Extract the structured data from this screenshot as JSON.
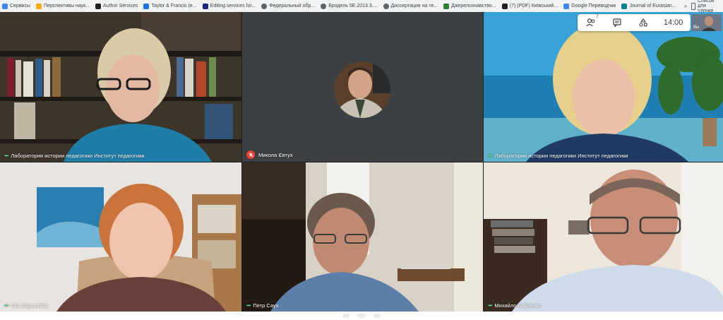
{
  "bookmarks": {
    "items": [
      {
        "label": "Сервисы",
        "icon": "apps-grid-icon",
        "color": "#4285f4"
      },
      {
        "label": "Перспективы наук...",
        "icon": "folder-icon",
        "color": "#f9ab00"
      },
      {
        "label": "Author Services",
        "icon": "page-icon",
        "color": "#202124"
      },
      {
        "label": "Taylor & Francis (e...",
        "icon": "page-icon",
        "color": "#1a73e8"
      },
      {
        "label": "Editing services for...",
        "icon": "page-icon",
        "color": "#1a237e"
      },
      {
        "label": "Федеральный обр...",
        "icon": "globe-icon",
        "color": "#5f6368"
      },
      {
        "label": "Бродель 5Е.2013.3....",
        "icon": "globe-icon",
        "color": "#5f6368"
      },
      {
        "label": "Диссертация на те...",
        "icon": "globe-icon",
        "color": "#5f6368"
      },
      {
        "label": "Джерелознавство...",
        "icon": "page-icon",
        "color": "#2e7d32"
      },
      {
        "label": "(7) (PDF) Київський...",
        "icon": "page-icon",
        "color": "#202124"
      },
      {
        "label": "Google Переводчик",
        "icon": "translate-icon",
        "color": "#4285f4"
      },
      {
        "label": "Journal of Eurasian...",
        "icon": "page-icon",
        "color": "#00838f"
      }
    ],
    "more": "»",
    "reading_list": "Список для чтения"
  },
  "controls": {
    "people_count": "7",
    "time": "14:00",
    "self_label": "Вы"
  },
  "tiles": [
    {
      "name": "Лаборатория истории педагогики Институт педагогики",
      "muted": false
    },
    {
      "name": "Микола Євтух",
      "muted": true
    },
    {
      "name": "Лаборатория истории педагогики Институт педагогики",
      "muted": false
    },
    {
      "name": "Alla Zagorodnia",
      "muted": false
    },
    {
      "name": "Петр Саух",
      "muted": false
    },
    {
      "name": "Михайло Бойченко",
      "muted": false
    }
  ]
}
